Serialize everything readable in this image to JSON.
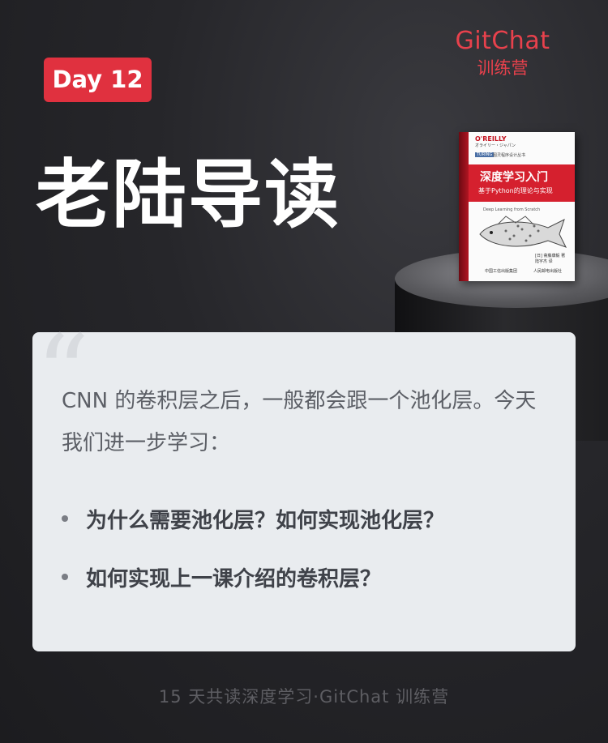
{
  "brand": {
    "name": "GitChat",
    "subtitle": "训练营"
  },
  "badge": {
    "label": "Day 12"
  },
  "headline": "老陆导读",
  "book": {
    "publisher_logo": "O'REILLY",
    "publisher_sub": "オライリー・ジャパン",
    "series_tag": "TURING",
    "series": "图灵程序设计丛书",
    "title": "深度学习入门",
    "subtitle": "基于Python的理论与实现",
    "english_title": "Deep Learning from Scratch",
    "author": "[日] 斋藤康毅 著",
    "translator": "陆宇杰 译",
    "press": "中国工信出版集团",
    "press2": "人民邮电出版社"
  },
  "card": {
    "intro": "CNN 的卷积层之后，一般都会跟一个池化层。今天我们进一步学习：",
    "bullets": [
      "为什么需要池化层？如何实现池化层？",
      "如何实现上一课介绍的卷积层？"
    ]
  },
  "footer": "15 天共读深度学习·GitChat 训练营",
  "colors": {
    "accent": "#e0313f",
    "background": "#26262a",
    "card": "#e9ecef"
  }
}
